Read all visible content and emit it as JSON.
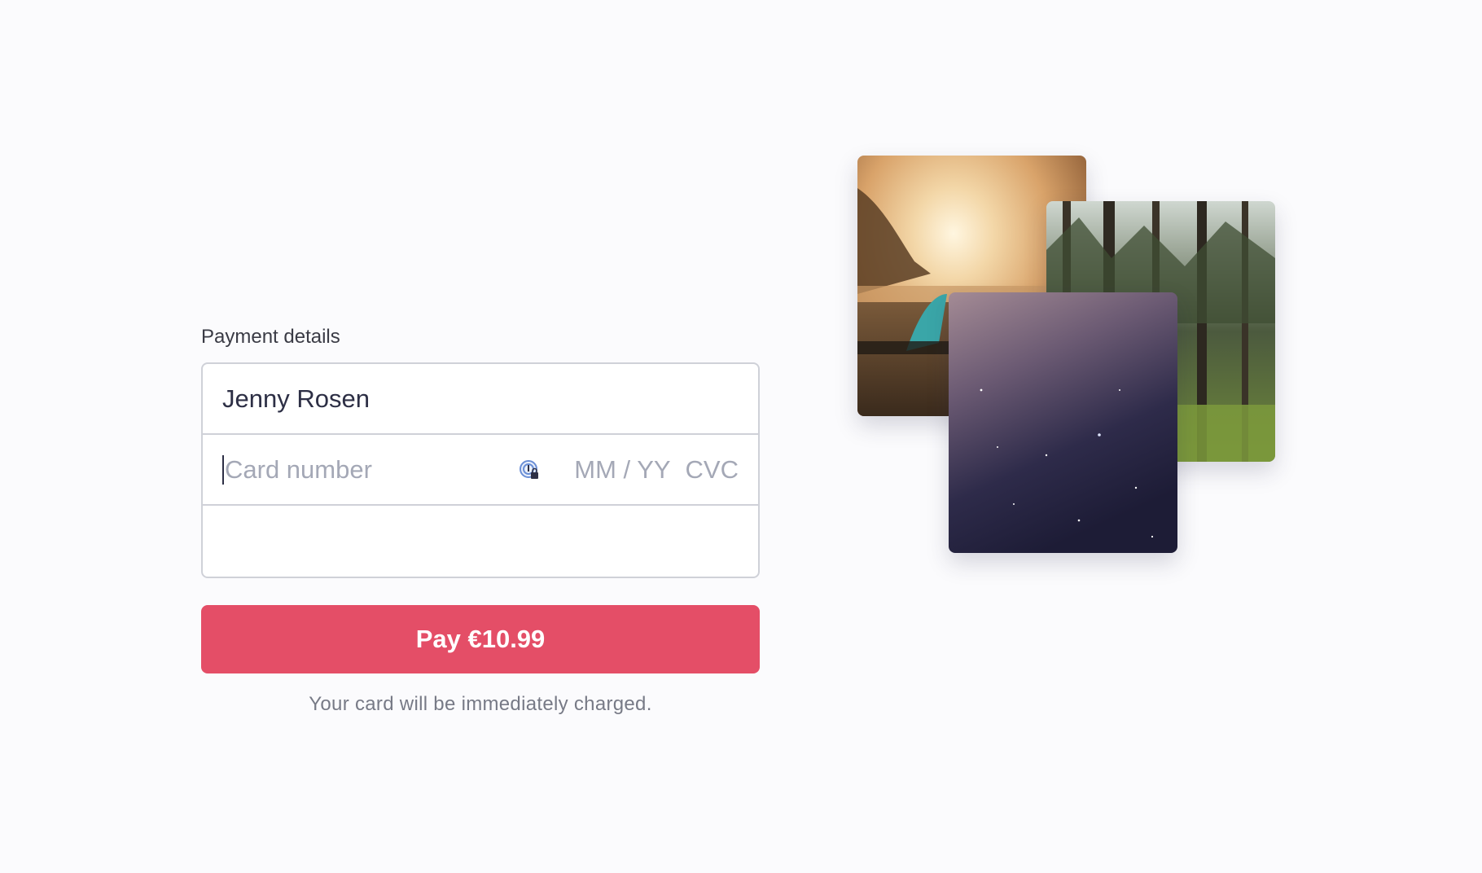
{
  "payment": {
    "section_label": "Payment details",
    "name_value": "Jenny Rosen",
    "card_number_placeholder": "Card number",
    "expiry_placeholder": "MM / YY",
    "cvc_placeholder": "CVC",
    "pay_button_label": "Pay €10.99",
    "note": "Your card will be immediately charged."
  },
  "images": [
    {
      "name": "beach-sunset-photo",
      "subject": "beach at sunset with surfboard"
    },
    {
      "name": "forest-photo",
      "subject": "pine forest"
    },
    {
      "name": "night-sky-photo",
      "subject": "starry night sky"
    }
  ],
  "colors": {
    "accent": "#e44e67",
    "text": "#2d2f45",
    "placeholder": "#a4a8b6",
    "border": "#cfd1d8",
    "background": "#fbfbfd"
  },
  "icons": {
    "autofill": "password-manager-lock-icon"
  }
}
